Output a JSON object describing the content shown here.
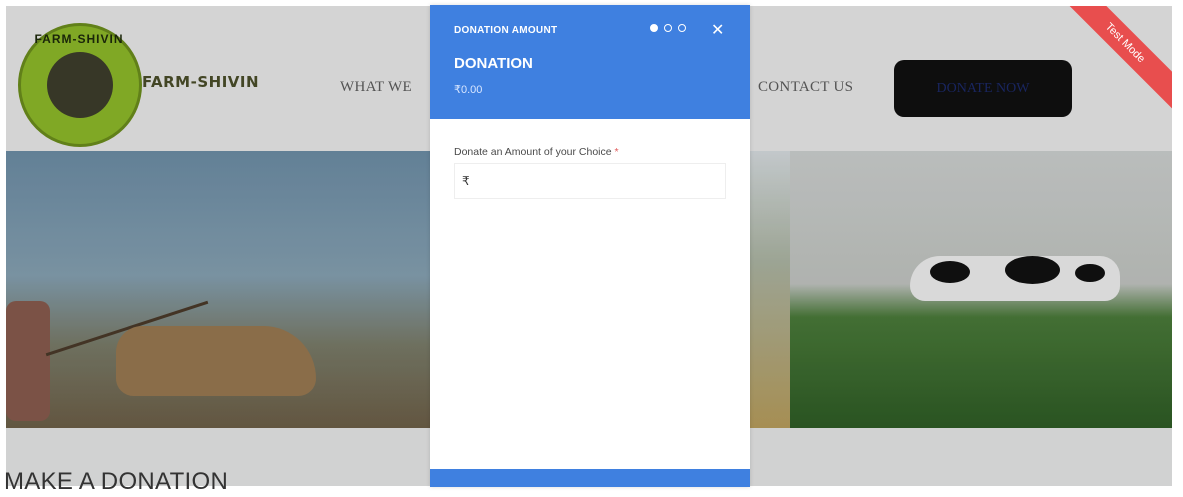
{
  "site": {
    "brand": "FARM-SHIVIN",
    "logo_text": "FARM-SHIVIN",
    "nav": {
      "what_we_partial": "WHAT WE",
      "contact": "CONTACT US"
    },
    "donate_button": "DONATE NOW",
    "test_mode_ribbon": "Test Mode",
    "section_heading": "MAKE A DONATION"
  },
  "modal": {
    "step_label": "DONATION AMOUNT",
    "steps": {
      "total": 3,
      "current": 1
    },
    "close_icon": "close-icon",
    "title": "DONATION",
    "amount_display": "₹0.00",
    "field_label": "Donate an Amount of your Choice",
    "required_marker": "*",
    "currency_symbol": "₹",
    "amount_input_value": ""
  },
  "colors": {
    "modal_header": "#3f80e0",
    "ribbon": "#e84e4e",
    "logo_green": "#8fbc2a"
  }
}
